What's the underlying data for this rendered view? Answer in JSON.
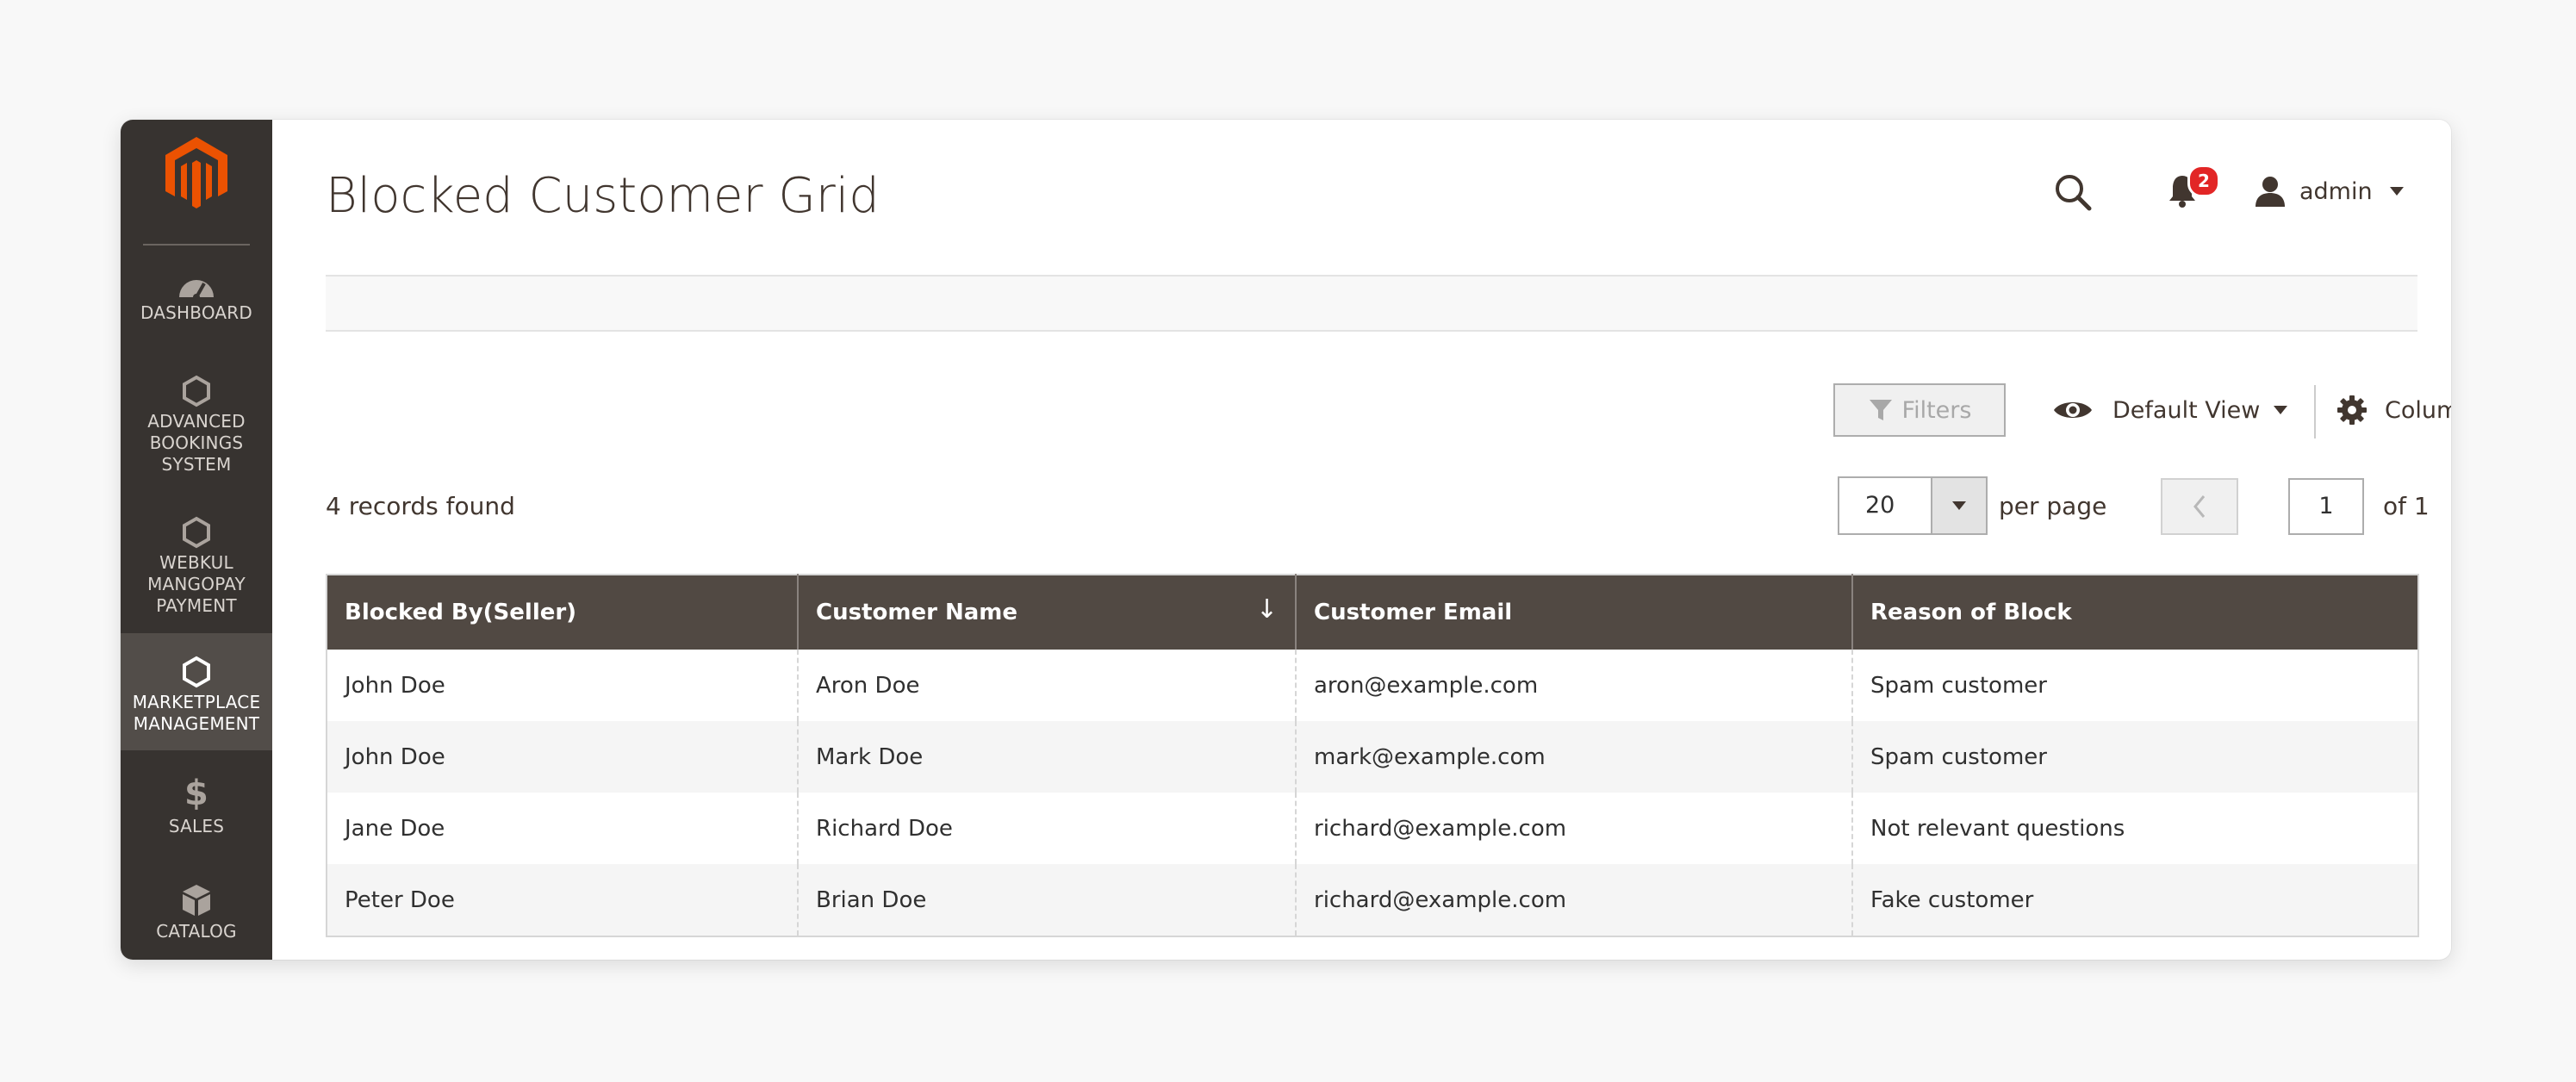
{
  "sidebar": {
    "items": [
      {
        "label": "Dashboard",
        "icon": "dashboard-icon",
        "active": false
      },
      {
        "label": "Advanced Bookings System",
        "icon": "hexagon-icon",
        "active": false
      },
      {
        "label": "Webkul Mangopay Payment",
        "icon": "hexagon-icon",
        "active": false
      },
      {
        "label": "Marketplace Management",
        "icon": "hexagon-icon",
        "active": true
      },
      {
        "label": "Sales",
        "icon": "dollar-icon",
        "active": false
      },
      {
        "label": "Catalog",
        "icon": "box-icon",
        "active": false
      }
    ]
  },
  "header": {
    "title": "Blocked Customer Grid",
    "notification_count": "2",
    "user_name": "admin"
  },
  "toolbar": {
    "filters_label": "Filters",
    "view_label": "Default View",
    "columns_label": "Columns",
    "records_found": "4 records found",
    "per_page_value": "20",
    "per_page_label": "per page",
    "current_page": "1",
    "page_of": "of 1"
  },
  "table": {
    "headers": [
      "Blocked By(Seller)",
      "Customer Name",
      "Customer Email",
      "Reason of Block"
    ],
    "sort_indicator": "↓",
    "rows": [
      [
        "John Doe",
        "Aron Doe",
        "aron@example.com",
        "Spam customer"
      ],
      [
        "John Doe",
        "Mark Doe",
        "mark@example.com",
        "Spam customer"
      ],
      [
        "Jane Doe",
        "Richard Doe",
        "richard@example.com",
        "Not relevant questions"
      ],
      [
        "Peter Doe",
        "Brian Doe",
        "richard@example.com",
        "Fake customer"
      ]
    ]
  },
  "colors": {
    "sidebar_bg": "#373330",
    "sidebar_active": "#524d49",
    "header_bg": "#514943",
    "brand_orange": "#eb5202",
    "badge_red": "#e22626"
  }
}
